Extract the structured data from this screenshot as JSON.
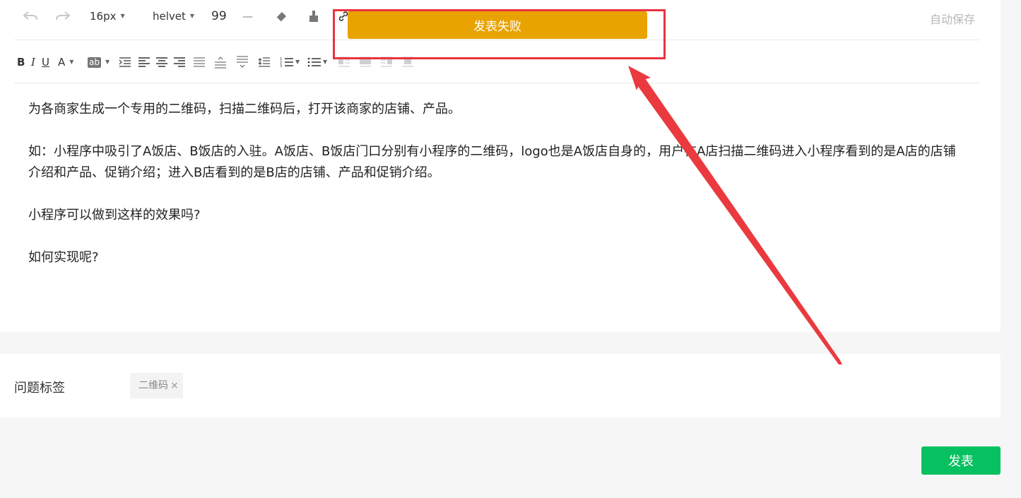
{
  "toolbar": {
    "font_size": "16px",
    "font_family": "helvet",
    "quote_glyph": "99",
    "hr_glyph": "—",
    "autosave": "自动保存",
    "icons": [
      "undo-icon",
      "redo-icon",
      "eraser-icon",
      "format-brush-icon",
      "link-icon"
    ]
  },
  "format_toolbar": {
    "bold": "B",
    "italic": "I",
    "underline": "U",
    "font_color": "A",
    "bg_color": "ab"
  },
  "toast": {
    "message": "发表失败",
    "color": "#e9a300"
  },
  "content": {
    "paragraphs": [
      "为各商家生成一个专用的二维码，扫描二维码后，打开该商家的店铺、产品。",
      "如：小程序中吸引了A饭店、B饭店的入驻。A饭店、B饭店门口分别有小程序的二维码，logo也是A饭店自身的，用户在A店扫描二维码进入小程序看到的是A店的店铺介绍和产品、促销介绍；进入B店看到的是B店的店铺、产品和促销介绍。",
      "小程序可以做到这样的效果吗?",
      "如何实现呢?"
    ]
  },
  "tags": {
    "label": "问题标签",
    "items": [
      {
        "text": "二维码",
        "remove": "×"
      }
    ]
  },
  "actions": {
    "publish": "发表",
    "publish_color": "#07c160"
  },
  "annotation": {
    "box_color": "#e9333f"
  }
}
